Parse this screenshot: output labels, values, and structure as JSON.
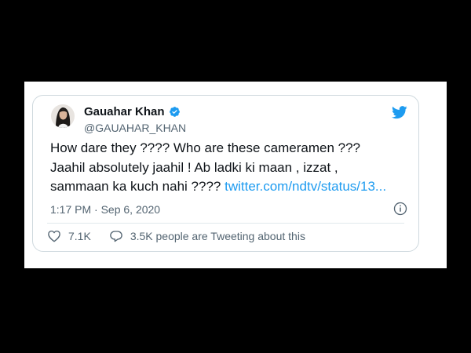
{
  "tweet": {
    "display_name": "Gauahar Khan",
    "handle": "@GAUAHAR_KHAN",
    "text_main": "How dare they ???? Who are these cameramen ??? Jaahil absolutely jaahil ! Ab ladki ki maan , izzat , sammaan ka kuch nahi ???? ",
    "link_text": "twitter.com/ndtv/status/13...",
    "timestamp": "1:17 PM · Sep 6, 2020",
    "likes": "7.1K",
    "replies_text": "3.5K people are Tweeting about this"
  },
  "icons": {
    "verified": "verified-badge-icon",
    "brand": "twitter-bird-icon",
    "info": "info-icon",
    "like": "heart-icon",
    "reply": "speech-bubble-icon"
  },
  "colors": {
    "accent": "#1d9bf0",
    "text": "#0f1419",
    "muted": "#536471",
    "border": "#cfd9de"
  }
}
